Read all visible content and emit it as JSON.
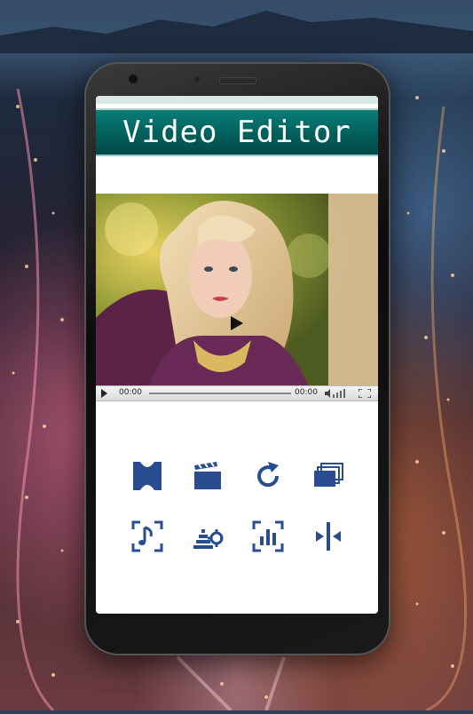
{
  "app": {
    "title": "Video Editor"
  },
  "player": {
    "current_time": "00:00",
    "total_time": "00:00"
  },
  "tools": [
    {
      "icon": "film-trim-icon"
    },
    {
      "icon": "clapperboard-icon"
    },
    {
      "icon": "rotate-icon"
    },
    {
      "icon": "layers-icon"
    },
    {
      "icon": "audio-music-icon"
    },
    {
      "icon": "effects-settings-icon"
    },
    {
      "icon": "equalizer-crop-icon"
    },
    {
      "icon": "split-icon"
    }
  ],
  "colors": {
    "title_band": "#02615d",
    "icon_blue": "#2a4d8f",
    "screen_bg": "#ffffff"
  }
}
